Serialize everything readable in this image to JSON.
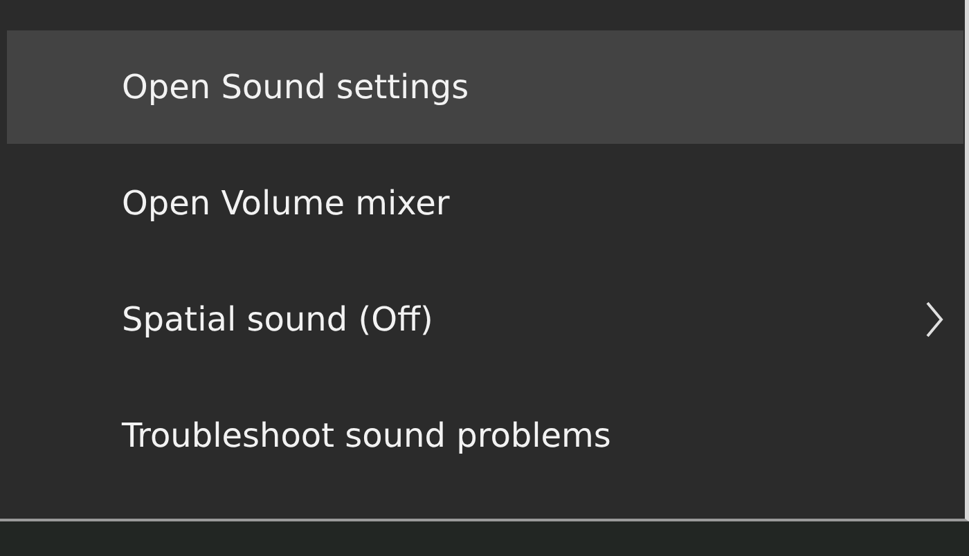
{
  "menu": {
    "items": [
      {
        "label": "Open Sound settings",
        "selected": true,
        "has_submenu": false
      },
      {
        "label": "Open Volume mixer",
        "selected": false,
        "has_submenu": false
      },
      {
        "label": "Spatial sound (Off)",
        "selected": false,
        "has_submenu": true
      },
      {
        "label": "Troubleshoot sound problems",
        "selected": false,
        "has_submenu": false
      }
    ]
  }
}
